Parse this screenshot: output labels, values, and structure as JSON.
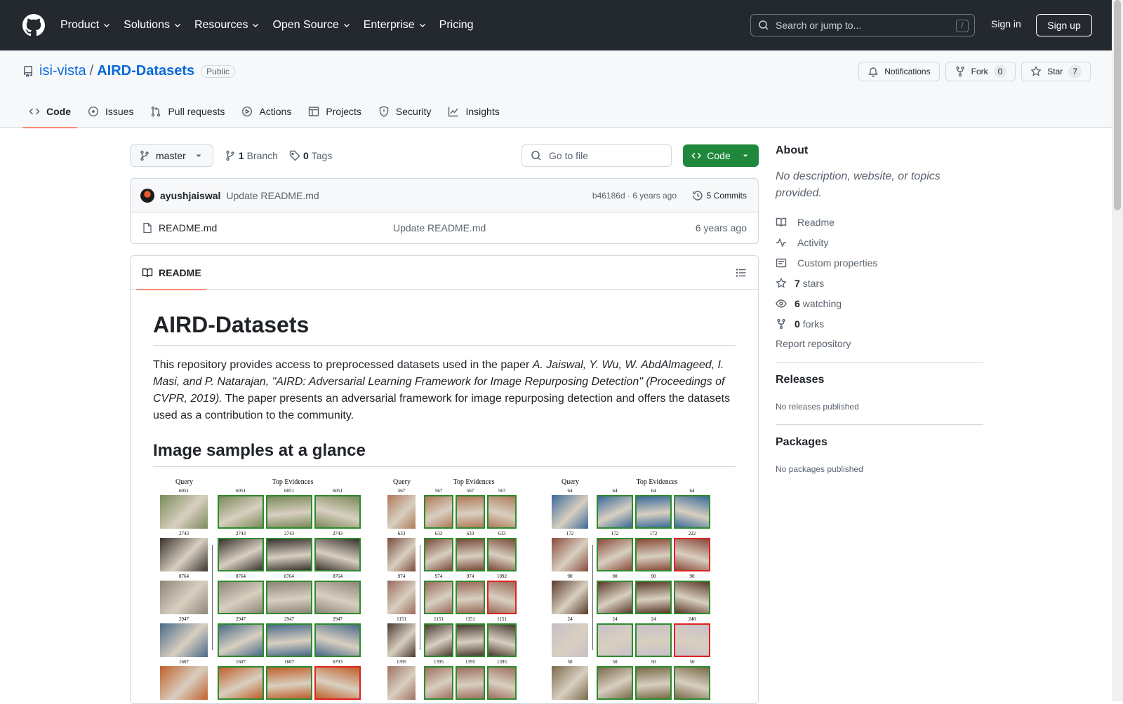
{
  "header": {
    "nav": [
      "Product",
      "Solutions",
      "Resources",
      "Open Source",
      "Enterprise",
      "Pricing"
    ],
    "search_placeholder": "Search or jump to...",
    "search_key": "/",
    "sign_in": "Sign in",
    "sign_up": "Sign up"
  },
  "repo": {
    "owner": "isi-vista",
    "separator": "/",
    "name": "AIRD-Datasets",
    "visibility": "Public",
    "notifications_label": "Notifications",
    "fork_label": "Fork",
    "fork_count": "0",
    "star_label": "Star",
    "star_count": "7",
    "tabs": [
      "Code",
      "Issues",
      "Pull requests",
      "Actions",
      "Projects",
      "Security",
      "Insights"
    ]
  },
  "filenav": {
    "branch": "master",
    "branch_count": "1",
    "branch_label": "Branch",
    "tag_count": "0",
    "tag_label": "Tags",
    "goto_placeholder": "Go to file",
    "code_button": "Code"
  },
  "commit": {
    "author": "ayushjaiswal",
    "message": "Update README.md",
    "meta": "b46186d · 6 years ago",
    "commits": "5 Commits"
  },
  "files": [
    {
      "name": "README.md",
      "commit": "Update README.md",
      "age": "6 years ago"
    }
  ],
  "readme": {
    "tab": "README",
    "title": "AIRD-Datasets",
    "para_start": "This repository provides access to preprocessed datasets used in the paper ",
    "para_italic": "A. Jaiswal, Y. Wu, W. AbdAlmageed, I. Masi, and P. Natarajan, \"AIRD: Adversarial Learning Framework for Image Repurposing Detection\" (Proceedings of CVPR, 2019).",
    "para_end": " The paper presents an adversarial framework for image repurposing detection and offers the datasets used as a contribution to the community.",
    "h2": "Image samples at a glance",
    "figure": {
      "query_label": "Query",
      "evidence_label": "Top Evidences",
      "panel1_nums": [
        [
          "6051",
          "6051",
          "6051",
          "6051"
        ],
        [
          "2743",
          "2743",
          "2743",
          "2743"
        ],
        [
          "8764",
          "8764",
          "8764",
          "8764"
        ],
        [
          "2947",
          "2947",
          "2947",
          "2947"
        ],
        [
          "1607",
          "1607",
          "1607",
          "6793"
        ]
      ],
      "panel2_nums": [
        [
          "567",
          "567",
          "567",
          "567"
        ],
        [
          "633",
          "633",
          "633",
          "633"
        ],
        [
          "974",
          "974",
          "974",
          "1092"
        ],
        [
          "1151",
          "1151",
          "1151",
          "1151"
        ],
        [
          "1395",
          "1395",
          "1395",
          "1395"
        ]
      ],
      "panel3_nums": [
        [
          "64",
          "64",
          "64",
          "64"
        ],
        [
          "172",
          "172",
          "172",
          "222"
        ],
        [
          "90",
          "90",
          "90",
          "90"
        ],
        [
          "24",
          "24",
          "24",
          "248"
        ],
        [
          "50",
          "50",
          "50",
          "50"
        ]
      ]
    }
  },
  "sidebar": {
    "about": "About",
    "description": "No description, website, or topics provided.",
    "links": [
      {
        "icon": "book-icon",
        "bold": "",
        "text": "Readme"
      },
      {
        "icon": "pulse-icon",
        "bold": "",
        "text": "Activity"
      },
      {
        "icon": "note-icon",
        "bold": "",
        "text": "Custom properties"
      },
      {
        "icon": "star-icon",
        "bold": "7",
        "text": "stars"
      },
      {
        "icon": "eye-icon",
        "bold": "6",
        "text": "watching"
      },
      {
        "icon": "fork-icon",
        "bold": "0",
        "text": "forks"
      }
    ],
    "report": "Report repository",
    "releases": "Releases",
    "releases_none": "No releases published",
    "packages": "Packages",
    "packages_none": "No packages published"
  },
  "colors": {
    "header_bg": "#24292f",
    "link": "#0969da",
    "green_button": "#1f883d",
    "tab_underline": "#fd8c73",
    "evidence_good": "#2e8b2e",
    "evidence_bad": "#dd2222"
  }
}
